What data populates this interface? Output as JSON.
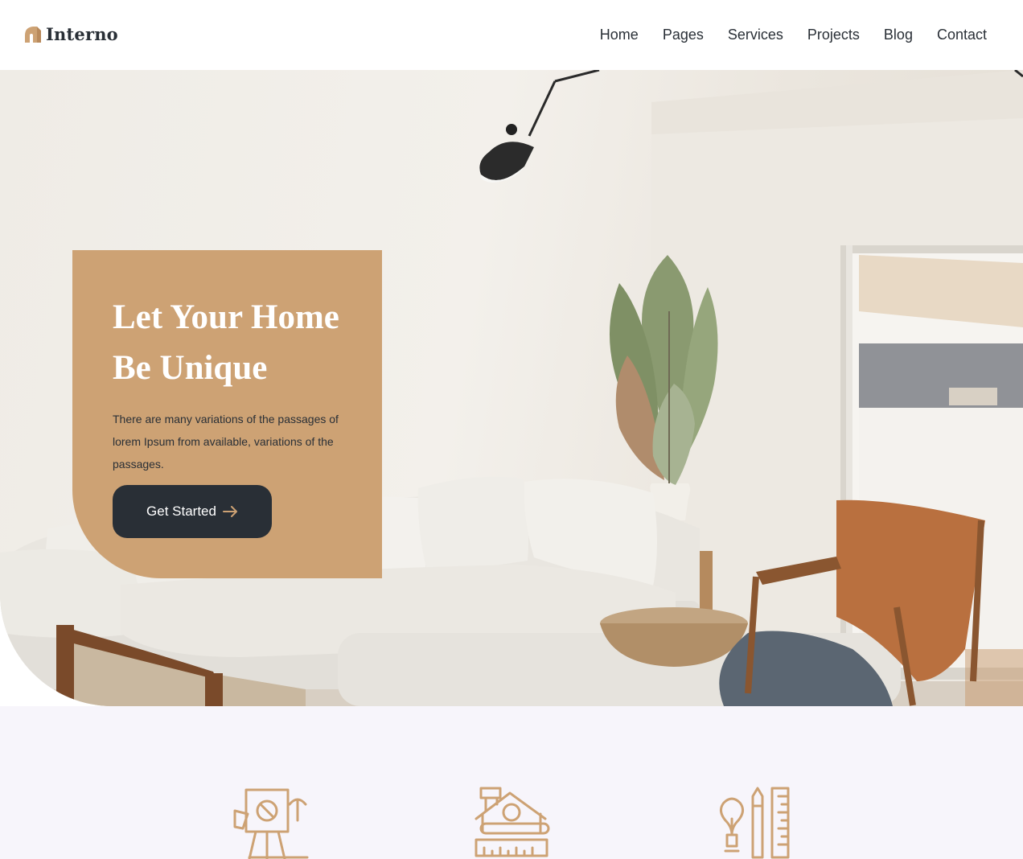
{
  "header": {
    "brand": "Interno",
    "nav": [
      "Home",
      "Pages",
      "Services",
      "Projects",
      "Blog",
      "Contact"
    ]
  },
  "hero": {
    "title_line1": "Let Your Home",
    "title_line2": "Be Unique",
    "description": "There are many variations of the passages of lorem Ipsum from available, variations of the passages.",
    "cta_label": "Get Started"
  },
  "services": {
    "icons": [
      "design-easel-icon",
      "house-blueprint-icon",
      "idea-tools-icon"
    ]
  },
  "colors": {
    "accent": "#cda274",
    "dark": "#292f36",
    "section_bg": "#f7f5fb",
    "white": "#ffffff"
  }
}
